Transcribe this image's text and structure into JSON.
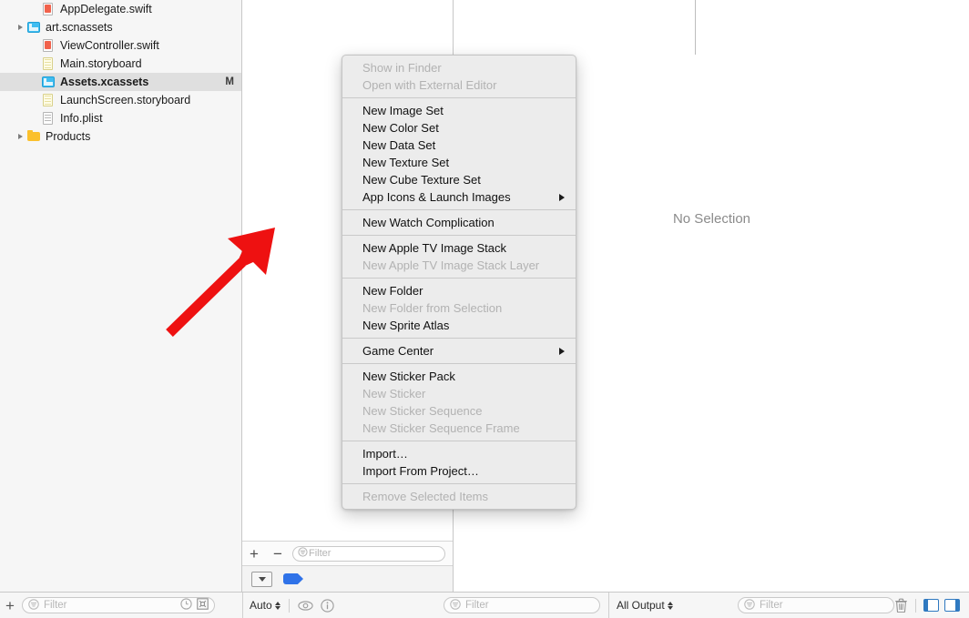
{
  "sidebar": {
    "items": [
      {
        "label": "AppDelegate.swift",
        "icon": "swift-file-icon",
        "indent": 1,
        "expandable": false,
        "selected": false,
        "status": ""
      },
      {
        "label": "art.scnassets",
        "icon": "xcassets-icon",
        "indent": 0,
        "expandable": true,
        "selected": false,
        "status": ""
      },
      {
        "label": "ViewController.swift",
        "icon": "swift-file-icon",
        "indent": 1,
        "expandable": false,
        "selected": false,
        "status": ""
      },
      {
        "label": "Main.storyboard",
        "icon": "storyboard-icon",
        "indent": 1,
        "expandable": false,
        "selected": false,
        "status": ""
      },
      {
        "label": "Assets.xcassets",
        "icon": "xcassets-icon",
        "indent": 1,
        "expandable": false,
        "selected": true,
        "status": "M"
      },
      {
        "label": "LaunchScreen.storyboard",
        "icon": "storyboard-icon",
        "indent": 1,
        "expandable": false,
        "selected": false,
        "status": ""
      },
      {
        "label": "Info.plist",
        "icon": "plist-icon",
        "indent": 1,
        "expandable": false,
        "selected": false,
        "status": ""
      },
      {
        "label": "Products",
        "icon": "folder-icon",
        "indent": 0,
        "expandable": true,
        "selected": false,
        "status": ""
      }
    ]
  },
  "asset_list": {
    "add_label": "+",
    "remove_label": "−",
    "filter_placeholder": "Filter"
  },
  "detail": {
    "no_selection": "No Selection"
  },
  "bottom_bar": {
    "add_label": "+",
    "navigator_filter_placeholder": "Filter",
    "layout_popup": "Auto",
    "debug_filter_placeholder": "Filter",
    "output_popup": "All Output",
    "console_filter_placeholder": "Filter"
  },
  "context_menu": {
    "groups": [
      {
        "items": [
          {
            "label": "Show in Finder",
            "disabled": true,
            "submenu": false
          },
          {
            "label": "Open with External Editor",
            "disabled": true,
            "submenu": false
          }
        ]
      },
      {
        "items": [
          {
            "label": "New Image Set",
            "disabled": false,
            "submenu": false
          },
          {
            "label": "New Color Set",
            "disabled": false,
            "submenu": false
          },
          {
            "label": "New Data Set",
            "disabled": false,
            "submenu": false
          },
          {
            "label": "New Texture Set",
            "disabled": false,
            "submenu": false
          },
          {
            "label": "New Cube Texture Set",
            "disabled": false,
            "submenu": false
          },
          {
            "label": "App Icons & Launch Images",
            "disabled": false,
            "submenu": true
          }
        ]
      },
      {
        "items": [
          {
            "label": "New Watch Complication",
            "disabled": false,
            "submenu": false
          }
        ]
      },
      {
        "items": [
          {
            "label": "New Apple TV Image Stack",
            "disabled": false,
            "submenu": false
          },
          {
            "label": "New Apple TV Image Stack Layer",
            "disabled": true,
            "submenu": false
          }
        ]
      },
      {
        "items": [
          {
            "label": "New Folder",
            "disabled": false,
            "submenu": false
          },
          {
            "label": "New Folder from Selection",
            "disabled": true,
            "submenu": false
          },
          {
            "label": "New Sprite Atlas",
            "disabled": false,
            "submenu": false
          }
        ]
      },
      {
        "items": [
          {
            "label": "Game Center",
            "disabled": false,
            "submenu": true
          }
        ]
      },
      {
        "items": [
          {
            "label": "New Sticker Pack",
            "disabled": false,
            "submenu": false
          },
          {
            "label": "New Sticker",
            "disabled": true,
            "submenu": false
          },
          {
            "label": "New Sticker Sequence",
            "disabled": true,
            "submenu": false
          },
          {
            "label": "New Sticker Sequence Frame",
            "disabled": true,
            "submenu": false
          }
        ]
      },
      {
        "items": [
          {
            "label": "Import…",
            "disabled": false,
            "submenu": false
          },
          {
            "label": "Import From Project…",
            "disabled": false,
            "submenu": false
          }
        ]
      },
      {
        "items": [
          {
            "label": "Remove Selected Items",
            "disabled": true,
            "submenu": false
          }
        ]
      }
    ]
  },
  "annotation": {
    "arrow_color": "#ee1111"
  },
  "colors": {
    "selection_row": "#dfdfdf",
    "menu_background": "#ececec",
    "accent_blue": "#2f79c0",
    "tag_blue": "#2f72e8",
    "folder_yellow": "#fbc02d",
    "xcassets_blue": "#3fbdf1"
  }
}
